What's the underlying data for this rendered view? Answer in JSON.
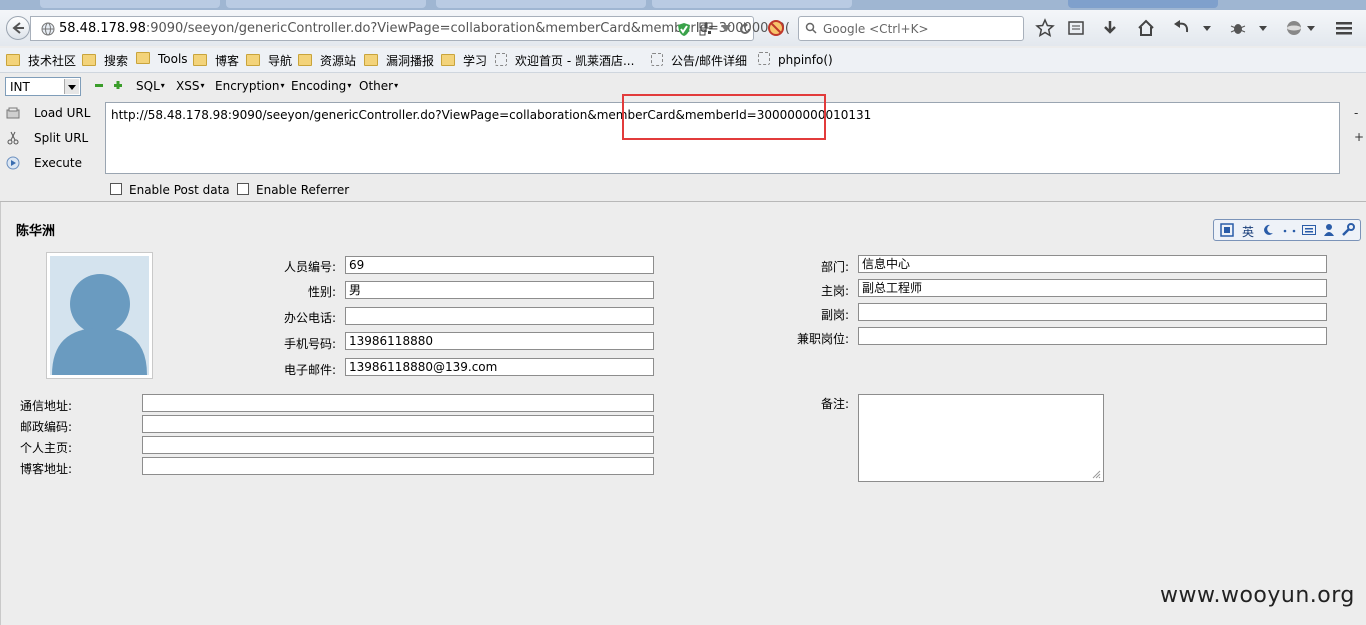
{
  "browser": {
    "url_host": "58.48.178.98",
    "url_rest": ":9090/seeyon/genericController.do?ViewPage=collaboration&memberCard&memberId=30000000(",
    "search_placeholder": "Google <Ctrl+K>"
  },
  "bookmarks": [
    {
      "label": "技术社区",
      "kind": "folder"
    },
    {
      "label": "搜索",
      "kind": "folder"
    },
    {
      "label": "Tools",
      "kind": "folder"
    },
    {
      "label": "博客",
      "kind": "folder"
    },
    {
      "label": "导航",
      "kind": "folder"
    },
    {
      "label": "资源站",
      "kind": "folder"
    },
    {
      "label": "漏洞播报",
      "kind": "folder"
    },
    {
      "label": "学习",
      "kind": "folder"
    },
    {
      "label": "欢迎首页 - 凯莱酒店...",
      "kind": "page"
    },
    {
      "label": "公告/邮件详细",
      "kind": "page"
    },
    {
      "label": "phpinfo()",
      "kind": "page"
    }
  ],
  "hackbar": {
    "select_value": "INT",
    "menus": [
      "SQL",
      "XSS",
      "Encryption",
      "Encoding",
      "Other"
    ],
    "load_url": "Load URL",
    "split_url": "Split URL",
    "execute": "Execute",
    "url_text": "http://58.48.178.98:9090/seeyon/genericController.do?ViewPage=collaboration&memberCard&memberId=300000000010131",
    "enable_post": "Enable Post data",
    "enable_referrer": "Enable Referrer",
    "side_minus": "-",
    "side_plus": "+"
  },
  "card": {
    "name": "陈华洲",
    "left_fields": [
      {
        "label": "人员编号:",
        "value": "69"
      },
      {
        "label": "性别:",
        "value": "男"
      },
      {
        "label": "办公电话:",
        "value": ""
      },
      {
        "label": "手机号码:",
        "value": "13986118880"
      },
      {
        "label": "电子邮件:",
        "value": "13986118880@139.com"
      }
    ],
    "right_fields": [
      {
        "label": "部门:",
        "value": "信息中心"
      },
      {
        "label": "主岗:",
        "value": "副总工程师"
      },
      {
        "label": "副岗:",
        "value": ""
      },
      {
        "label": "兼职岗位:",
        "value": ""
      }
    ],
    "contact_fields": [
      {
        "label": "通信地址:",
        "value": ""
      },
      {
        "label": "邮政编码:",
        "value": ""
      },
      {
        "label": "个人主页:",
        "value": ""
      },
      {
        "label": "博客地址:",
        "value": ""
      }
    ],
    "notes_label": "备注:",
    "notes_value": ""
  },
  "ime": {
    "lang": "英"
  },
  "watermark": "www.wooyun.org"
}
